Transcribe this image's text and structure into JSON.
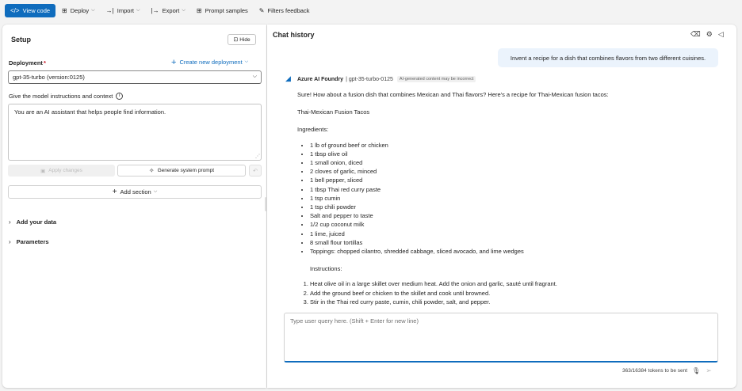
{
  "toolbar": {
    "view_code": "View code",
    "deploy": "Deploy",
    "import": "Import",
    "export": "Export",
    "prompt_samples": "Prompt samples",
    "filters_feedback": "Filters feedback"
  },
  "setup": {
    "title": "Setup",
    "hide_label": "Hide",
    "deployment_label": "Deployment",
    "required_marker": "*",
    "create_new_deployment": "Create new deployment",
    "deployment_value": "gpt-35-turbo (version:0125)",
    "instructions_label": "Give the model instructions and context",
    "system_prompt": "You are an AI assistant that helps people find information.",
    "apply_changes": "Apply changes",
    "generate_system_prompt": "Generate system prompt",
    "add_section": "Add section",
    "add_your_data": "Add your data",
    "parameters": "Parameters"
  },
  "chat": {
    "title": "Chat history",
    "user_message": "Invent a recipe for a dish that combines flavors from two different cuisines.",
    "bot_name": "Azure AI Foundry",
    "bot_model": "| gpt-35-turbo-0125",
    "ai_badge": "AI-generated content may be incorrect",
    "intro": "Sure! How about a fusion dish that combines Mexican and Thai flavors? Here's a recipe for Thai-Mexican fusion tacos:",
    "dish_title": "Thai-Mexican Fusion Tacos",
    "ingredients_label": "Ingredients:",
    "ingredients": [
      "1 lb of ground beef or chicken",
      "1 tbsp olive oil",
      "1 small onion, diced",
      "2 cloves of garlic, minced",
      "1 bell pepper, sliced",
      "1 tbsp Thai red curry paste",
      "1 tsp cumin",
      "1 tsp chili powder",
      "Salt and pepper to taste",
      "1/2 cup coconut milk",
      "1 lime, juiced",
      "8 small flour tortillas",
      "Toppings: chopped cilantro, shredded cabbage, sliced avocado, and lime wedges"
    ],
    "instructions_label": "Instructions:",
    "steps": [
      "Heat olive oil in a large skillet over medium heat. Add the onion and garlic, sauté until fragrant.",
      "Add the ground beef or chicken to the skillet and cook until browned.",
      "Stir in the Thai red curry paste, cumin, chili powder, salt, and pepper."
    ],
    "input_placeholder": "Type user query here. (Shift + Enter for new line)",
    "token_info": "363/16384 tokens to be sent"
  },
  "icons": {
    "view_code": "code-icon",
    "deploy": "cube-icon",
    "import": "import-icon",
    "export": "export-icon",
    "prompt_samples": "grid-icon",
    "filters_feedback": "feedback-icon",
    "accent_color": "#0f6cbd"
  }
}
